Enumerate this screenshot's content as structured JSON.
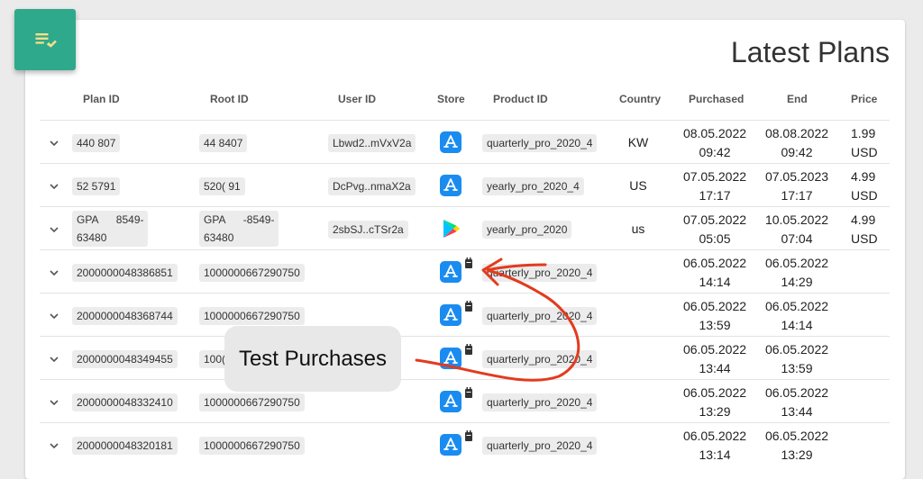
{
  "page": {
    "title": "Latest Plans",
    "badge_icon": "playlist-check-icon"
  },
  "columns": [
    "Plan ID",
    "Root ID",
    "User ID",
    "Store",
    "Product ID",
    "Country",
    "Purchased",
    "End",
    "Price"
  ],
  "rows": [
    {
      "plan_id": "440      807",
      "root_id": "44      8407",
      "user_id": "Lbwd2..mVxV2a",
      "store": "app-store",
      "sandbox": false,
      "product_id": "quarterly_pro_2020_4",
      "country": "KW",
      "purchased_date": "08.05.2022",
      "purchased_time": "09:42",
      "end_date": "08.08.2022",
      "end_time": "09:42",
      "price_amount": "1.99",
      "price_currency": "USD"
    },
    {
      "plan_id": "52      5791",
      "root_id": "520(      91",
      "user_id": "DcPvg..nmaX2a",
      "store": "app-store",
      "sandbox": false,
      "product_id": "yearly_pro_2020_4",
      "country": "US",
      "purchased_date": "07.05.2022",
      "purchased_time": "17:17",
      "end_date": "07.05.2023",
      "end_time": "17:17",
      "price_amount": "4.99",
      "price_currency": "USD"
    },
    {
      "plan_id": "GPA      8549-\n63480",
      "root_id": "GPA      -8549-\n63480",
      "user_id": "2sbSJ..cTSr2a",
      "store": "google-play",
      "sandbox": false,
      "product_id": "yearly_pro_2020",
      "country": "us",
      "purchased_date": "07.05.2022",
      "purchased_time": "05:05",
      "end_date": "10.05.2022",
      "end_time": "07:04",
      "price_amount": "4.99",
      "price_currency": "USD"
    },
    {
      "plan_id": "2000000048386851",
      "root_id": "1000000667290750",
      "user_id": "",
      "store": "app-store",
      "sandbox": true,
      "product_id": "quarterly_pro_2020_4",
      "country": "",
      "purchased_date": "06.05.2022",
      "purchased_time": "14:14",
      "end_date": "06.05.2022",
      "end_time": "14:29",
      "price_amount": "",
      "price_currency": ""
    },
    {
      "plan_id": "2000000048368744",
      "root_id": "1000000667290750",
      "user_id": "",
      "store": "app-store",
      "sandbox": true,
      "product_id": "quarterly_pro_2020_4",
      "country": "",
      "purchased_date": "06.05.2022",
      "purchased_time": "13:59",
      "end_date": "06.05.2022",
      "end_time": "14:14",
      "price_amount": "",
      "price_currency": ""
    },
    {
      "plan_id": "2000000048349455",
      "root_id": "100(",
      "user_id": "",
      "store": "app-store",
      "sandbox": true,
      "product_id": "quarterly_pro_2020_4",
      "country": "",
      "purchased_date": "06.05.2022",
      "purchased_time": "13:44",
      "end_date": "06.05.2022",
      "end_time": "13:59",
      "price_amount": "",
      "price_currency": ""
    },
    {
      "plan_id": "2000000048332410",
      "root_id": "1000000667290750",
      "user_id": "",
      "store": "app-store",
      "sandbox": true,
      "product_id": "quarterly_pro_2020_4",
      "country": "",
      "purchased_date": "06.05.2022",
      "purchased_time": "13:29",
      "end_date": "06.05.2022",
      "end_time": "13:44",
      "price_amount": "",
      "price_currency": ""
    },
    {
      "plan_id": "2000000048320181",
      "root_id": "1000000667290750",
      "user_id": "",
      "store": "app-store",
      "sandbox": true,
      "product_id": "quarterly_pro_2020_4",
      "country": "",
      "purchased_date": "06.05.2022",
      "purchased_time": "13:14",
      "end_date": "06.05.2022",
      "end_time": "13:29",
      "price_amount": "",
      "price_currency": ""
    }
  ],
  "annotation": {
    "label": "Test Purchases",
    "color": "#e23b1e"
  },
  "colors": {
    "accent": "#2fa98c",
    "app_store": "#1a8cf0",
    "annotation": "#e23b1e"
  }
}
